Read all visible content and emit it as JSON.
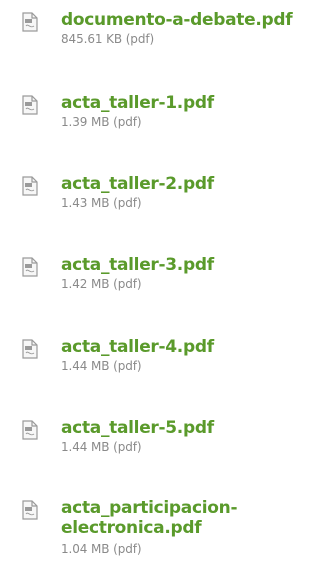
{
  "files": [
    {
      "name": "documento-a-debate.pdf",
      "meta": "845.61 KB (pdf)"
    },
    {
      "name": "acta_taller-1.pdf",
      "meta": "1.39 MB (pdf)"
    },
    {
      "name": "acta_taller-2.pdf",
      "meta": "1.43 MB (pdf)"
    },
    {
      "name": "acta_taller-3.pdf",
      "meta": "1.42 MB (pdf)"
    },
    {
      "name": "acta_taller-4.pdf",
      "meta": "1.44 MB (pdf)"
    },
    {
      "name": "acta_taller-5.pdf",
      "meta": "1.44 MB (pdf)"
    },
    {
      "name_lines": [
        "acta_participacion-",
        "electronica.pdf"
      ],
      "meta": "1.04 MB (pdf)"
    }
  ],
  "icon": "pdf-file-icon",
  "colors": {
    "link": "#5a9a2b",
    "meta": "#8a8a8a",
    "icon": "#9a9a9a"
  }
}
